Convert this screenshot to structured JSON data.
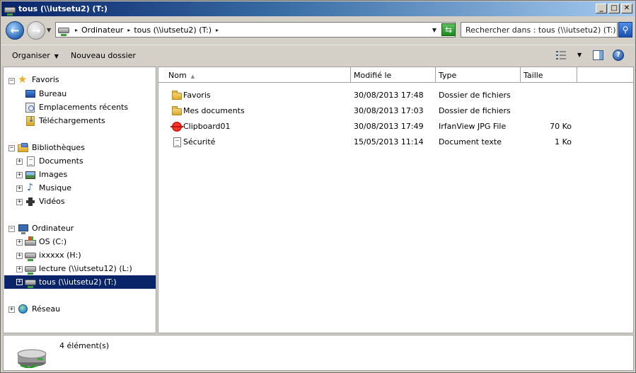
{
  "window": {
    "title": "tous (\\\\iutsetu2) (T:)"
  },
  "address": {
    "segments": [
      "Ordinateur",
      "tous (\\\\iutsetu2) (T:)"
    ],
    "search_placeholder": "Rechercher dans : tous (\\\\iutsetu2) (T:)"
  },
  "commands": {
    "organize": "Organiser",
    "new_folder": "Nouveau dossier"
  },
  "nav": {
    "favorites": {
      "label": "Favoris",
      "items": [
        "Bureau",
        "Emplacements récents",
        "Téléchargements"
      ]
    },
    "libraries": {
      "label": "Bibliothèques",
      "items": [
        "Documents",
        "Images",
        "Musique",
        "Vidéos"
      ]
    },
    "computer": {
      "label": "Ordinateur",
      "items": [
        "OS (C:)",
        "ixxxxx (H:)",
        "lecture (\\\\iutsetu12) (L:)",
        "tous (\\\\iutsetu2) (T:)"
      ]
    },
    "network": {
      "label": "Réseau"
    }
  },
  "columns": [
    "Nom",
    "Modifié le",
    "Type",
    "Taille"
  ],
  "files": [
    {
      "name": "Favoris",
      "modified": "30/08/2013 17:48",
      "type": "Dossier de fichiers",
      "size": "",
      "icon": "star-folder-icon"
    },
    {
      "name": "Mes documents",
      "modified": "30/08/2013 17:03",
      "type": "Dossier de fichiers",
      "size": "",
      "icon": "folder-icon"
    },
    {
      "name": "Clipboard01",
      "modified": "30/08/2013 17:49",
      "type": "IrfanView JPG File",
      "size": "70 Ko",
      "icon": "irfanview-icon"
    },
    {
      "name": "Sécurité",
      "modified": "15/05/2013 11:14",
      "type": "Document texte",
      "size": "1 Ko",
      "icon": "text-document-icon"
    }
  ],
  "details": {
    "count": "4 élément(s)"
  },
  "colors": {
    "selection": "#0a246a",
    "titlebar_start": "#0a246a",
    "titlebar_end": "#a6caf0"
  }
}
